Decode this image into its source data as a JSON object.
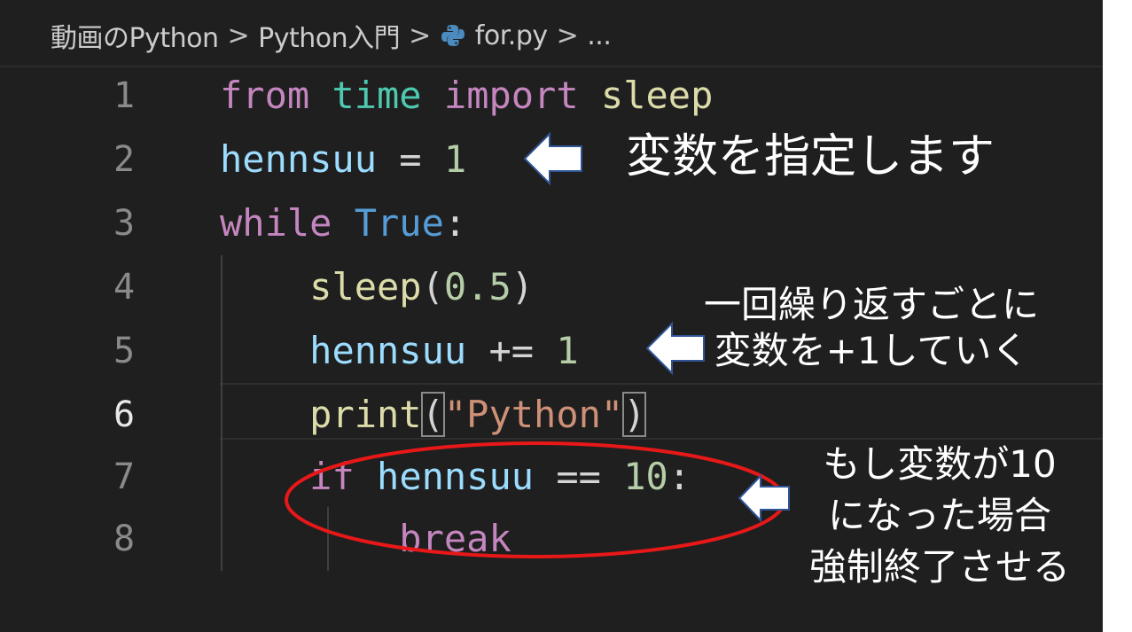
{
  "breadcrumb": {
    "items": [
      "動画のPython",
      "Python入門",
      "for.py",
      "..."
    ],
    "separator": ">"
  },
  "editor": {
    "lines": [
      {
        "number": "1",
        "tokens": [
          {
            "t": "from",
            "c": "kw"
          },
          {
            "t": " ",
            "c": "op"
          },
          {
            "t": "time",
            "c": "mod"
          },
          {
            "t": " ",
            "c": "op"
          },
          {
            "t": "import",
            "c": "kw"
          },
          {
            "t": " ",
            "c": "op"
          },
          {
            "t": "sleep",
            "c": "fn"
          }
        ]
      },
      {
        "number": "2",
        "tokens": [
          {
            "t": "hennsuu",
            "c": "var"
          },
          {
            "t": " = ",
            "c": "op"
          },
          {
            "t": "1",
            "c": "num"
          }
        ]
      },
      {
        "number": "3",
        "tokens": [
          {
            "t": "while",
            "c": "kw"
          },
          {
            "t": " ",
            "c": "op"
          },
          {
            "t": "True",
            "c": "const"
          },
          {
            "t": ":",
            "c": "op"
          }
        ]
      },
      {
        "number": "4",
        "tokens": [
          {
            "t": "    ",
            "c": "op"
          },
          {
            "t": "sleep",
            "c": "fn"
          },
          {
            "t": "(",
            "c": "op"
          },
          {
            "t": "0.5",
            "c": "num"
          },
          {
            "t": ")",
            "c": "op"
          }
        ]
      },
      {
        "number": "5",
        "tokens": [
          {
            "t": "    ",
            "c": "op"
          },
          {
            "t": "hennsuu",
            "c": "var"
          },
          {
            "t": " += ",
            "c": "op"
          },
          {
            "t": "1",
            "c": "num"
          }
        ]
      },
      {
        "number": "6",
        "tokens": [
          {
            "t": "    ",
            "c": "op"
          },
          {
            "t": "print",
            "c": "fn"
          },
          {
            "t": "(",
            "c": "bracket-box"
          },
          {
            "t": "\"Python\"",
            "c": "str"
          },
          {
            "t": ")",
            "c": "bracket-box"
          }
        ]
      },
      {
        "number": "7",
        "tokens": [
          {
            "t": "    ",
            "c": "op"
          },
          {
            "t": "if",
            "c": "kw"
          },
          {
            "t": " ",
            "c": "op"
          },
          {
            "t": "hennsuu",
            "c": "var"
          },
          {
            "t": " == ",
            "c": "op"
          },
          {
            "t": "10",
            "c": "num"
          },
          {
            "t": ":",
            "c": "op"
          }
        ]
      },
      {
        "number": "8",
        "tokens": [
          {
            "t": "        ",
            "c": "op"
          },
          {
            "t": "break",
            "c": "kw"
          }
        ]
      }
    ],
    "active_line": "6"
  },
  "annotations": {
    "a1": "変数を指定します",
    "a2_line1": "一回繰り返すごとに",
    "a2_line2": "変数を+1していく",
    "a3_line1": "もし変数が10",
    "a3_line2": "になった場合",
    "a3_line3": "強制終了させる"
  },
  "colors": {
    "background": "#1f1f1f",
    "keyword": "#c586c0",
    "module": "#4ec9b0",
    "function": "#dcdcaa",
    "variable": "#9cdcfe",
    "number": "#b5cea8",
    "string": "#ce9178",
    "constant": "#569cd6",
    "highlight_ellipse": "#e81818"
  },
  "icons": {
    "file_icon": "python-icon",
    "arrow": "arrow-left-icon"
  }
}
